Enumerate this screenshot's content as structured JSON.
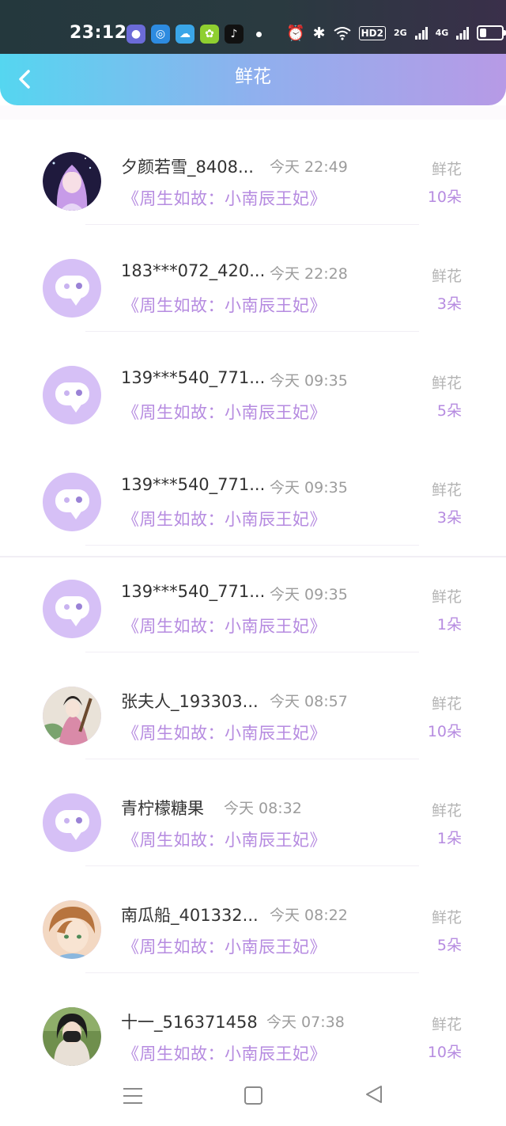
{
  "status_bar": {
    "time": "23:12",
    "app_icons": [
      {
        "icon": "app-bubble-icon",
        "color": "#6b6bd8"
      },
      {
        "icon": "app-circle-icon",
        "color": "#2d8be0"
      },
      {
        "icon": "app-cloud-icon",
        "color": "#3aa6e8"
      },
      {
        "icon": "app-green-icon",
        "color": "#8fcf30"
      },
      {
        "icon": "tiktok-icon",
        "color": "#111111"
      }
    ],
    "network_tag": "HD2",
    "signal_1": "2G",
    "signal_2": "4G"
  },
  "header": {
    "title": "鲜花"
  },
  "items": [
    {
      "name": "夕颜若雪_8408...",
      "time": "今天 22:49",
      "book": "《周生如故：小南辰王妃》",
      "kind": "鲜花",
      "count": "10朵",
      "avatar": "photo-anime-girl"
    },
    {
      "name": "183***072_420...",
      "time": "今天 22:28",
      "book": "《周生如故：小南辰王妃》",
      "kind": "鲜花",
      "count": "3朵",
      "avatar": "default-chat-icon"
    },
    {
      "name": "139***540_771...",
      "time": "今天 09:35",
      "book": "《周生如故：小南辰王妃》",
      "kind": "鲜花",
      "count": "5朵",
      "avatar": "default-chat-icon"
    },
    {
      "name": "139***540_771...",
      "time": "今天 09:35",
      "book": "《周生如故：小南辰王妃》",
      "kind": "鲜花",
      "count": "3朵",
      "avatar": "default-chat-icon"
    },
    {
      "name": "139***540_771...",
      "time": "今天 09:35",
      "book": "《周生如故：小南辰王妃》",
      "kind": "鲜花",
      "count": "1朵",
      "avatar": "default-chat-icon"
    },
    {
      "name": "张夫人_193303...",
      "time": "今天 08:57",
      "book": "《周生如故：小南辰王妃》",
      "kind": "鲜花",
      "count": "10朵",
      "avatar": "photo-costume-lady"
    },
    {
      "name": "青柠檬糖果",
      "time": "今天 08:32",
      "book": "《周生如故：小南辰王妃》",
      "kind": "鲜花",
      "count": "1朵",
      "avatar": "default-chat-icon"
    },
    {
      "name": "南瓜船_401332...",
      "time": "今天 08:22",
      "book": "《周生如故：小南辰王妃》",
      "kind": "鲜花",
      "count": "5朵",
      "avatar": "photo-anime-boy"
    },
    {
      "name": "十一_516371458",
      "time": "今天 07:38",
      "book": "《周生如故：小南辰王妃》",
      "kind": "鲜花",
      "count": "10朵",
      "avatar": "photo-masked-person"
    }
  ],
  "nav": {
    "menu_icon": "menu-icon",
    "home_icon": "home-icon",
    "back_icon": "back-triangle-icon"
  },
  "colors": {
    "accent_purple": "#b68be0",
    "header_gradient_start": "#55d6f0",
    "header_gradient_end": "#b79ae6",
    "avatar_placeholder": "#d6c0f6"
  }
}
